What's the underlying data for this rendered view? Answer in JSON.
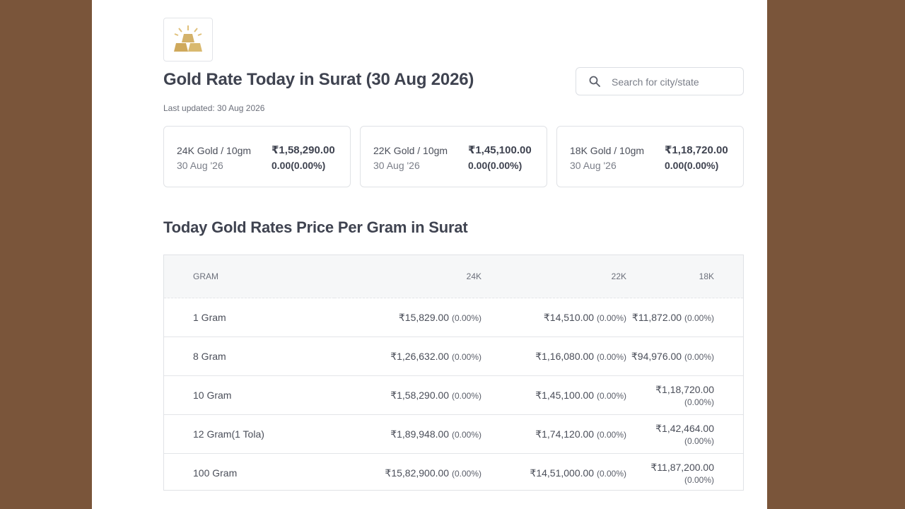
{
  "header": {
    "title": "Gold Rate Today in Surat (30 Aug 2026)",
    "last_updated": "Last updated: 30 Aug 2026",
    "logo_icon": "gold-bars-icon"
  },
  "search": {
    "placeholder": "Search for city/state",
    "value": "",
    "icon": "search-icon"
  },
  "cards": [
    {
      "label": "24K Gold / 10gm",
      "date": "30 Aug '26",
      "price": "₹1,58,290.00",
      "change": "0.00(0.00%)"
    },
    {
      "label": "22K Gold / 10gm",
      "date": "30 Aug '26",
      "price": "₹1,45,100.00",
      "change": "0.00(0.00%)"
    },
    {
      "label": "18K Gold / 10gm",
      "date": "30 Aug '26",
      "price": "₹1,18,720.00",
      "change": "0.00(0.00%)"
    }
  ],
  "table": {
    "title": "Today Gold Rates Price Per Gram in Surat",
    "headers": [
      "GRAM",
      "24K",
      "22K",
      "18K"
    ],
    "rows": [
      {
        "gram": "1 Gram",
        "k24": "₹15,829.00",
        "k24_chg": "(0.00%)",
        "k22": "₹14,510.00",
        "k22_chg": "(0.00%)",
        "k18": "₹11,872.00",
        "k18_chg": "(0.00%)"
      },
      {
        "gram": "8 Gram",
        "k24": "₹1,26,632.00",
        "k24_chg": "(0.00%)",
        "k22": "₹1,16,080.00",
        "k22_chg": "(0.00%)",
        "k18": "₹94,976.00",
        "k18_chg": "(0.00%)"
      },
      {
        "gram": "10 Gram",
        "k24": "₹1,58,290.00",
        "k24_chg": "(0.00%)",
        "k22": "₹1,45,100.00",
        "k22_chg": "(0.00%)",
        "k18": "₹1,18,720.00",
        "k18_chg": "(0.00%)"
      },
      {
        "gram": "12 Gram(1 Tola)",
        "k24": "₹1,89,948.00",
        "k24_chg": "(0.00%)",
        "k22": "₹1,74,120.00",
        "k22_chg": "(0.00%)",
        "k18": "₹1,42,464.00",
        "k18_chg": "(0.00%)"
      },
      {
        "gram": "100 Gram",
        "k24": "₹15,82,900.00",
        "k24_chg": "(0.00%)",
        "k22": "₹14,51,000.00",
        "k22_chg": "(0.00%)",
        "k18": "₹11,87,200.00",
        "k18_chg": "(0.00%)"
      }
    ]
  },
  "colors": {
    "outer_background": "#7a553a",
    "page_background": "#ffffff",
    "gold_accent": "#d4b26a",
    "text_primary": "#3f4350"
  }
}
